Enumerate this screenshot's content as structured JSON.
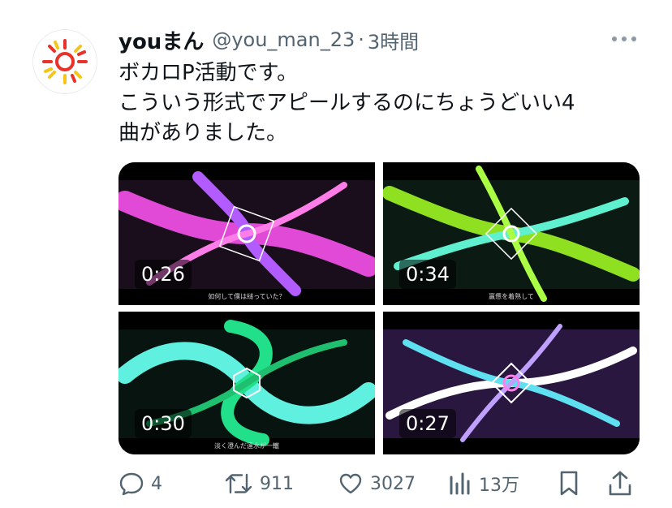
{
  "user": {
    "name": "youまん",
    "handle": "@you_man_23",
    "separator": "·",
    "time": "3時間"
  },
  "tweet": {
    "lines": [
      "ボカロP活動です。",
      "こういう形式でアピールするのにちょうどいい4",
      "曲がありました。"
    ]
  },
  "media": [
    {
      "duration": "0:26",
      "subtitle": "如何して僕は縋っていた？",
      "accent": "#e04ad6"
    },
    {
      "duration": "0:34",
      "subtitle": "羸憊を着熟して",
      "accent": "#8fe020"
    },
    {
      "duration": "0:30",
      "subtitle": "淡く澄んだ遠水が一轍",
      "accent": "#22e08a"
    },
    {
      "duration": "0:27",
      "subtitle": "",
      "accent": "#c0a0ff"
    }
  ],
  "actions": {
    "replies": "4",
    "retweets": "911",
    "likes": "3027",
    "views": "13万"
  },
  "colors": {
    "text": "#0f1419",
    "secondary": "#536471",
    "avatar_sun": "#e8322a",
    "avatar_rays": "#f5c518"
  }
}
